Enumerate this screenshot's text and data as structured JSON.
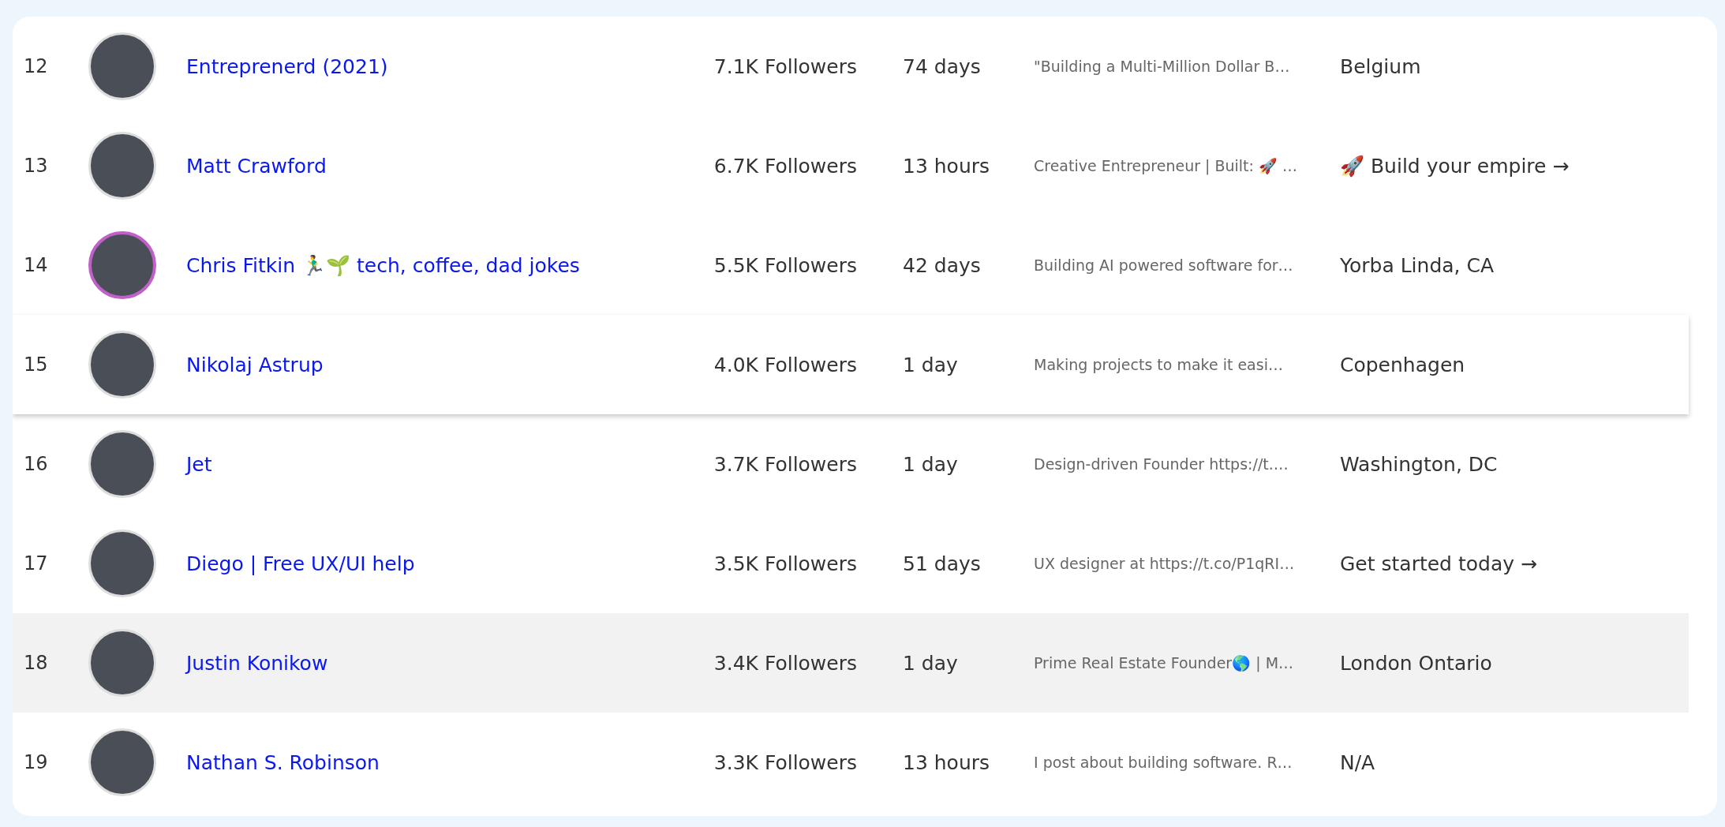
{
  "rows": [
    {
      "rank": "12",
      "name": "Entreprenerd (2021)",
      "followers": "7.1K Followers",
      "time": "74 days",
      "bio": "\"Building a Multi-Million Dollar B…",
      "location": "Belgium",
      "story_ring": false,
      "hovered": false,
      "shaded": false
    },
    {
      "rank": "13",
      "name": "Matt Crawford",
      "followers": "6.7K Followers",
      "time": "13 hours",
      "bio": "Creative Entrepreneur | Built: 🚀 …",
      "location": "🚀 Build your empire →",
      "story_ring": false,
      "hovered": false,
      "shaded": false
    },
    {
      "rank": "14",
      "name": "Chris Fitkin 🏃‍♂️🌱 tech, coffee, dad jokes",
      "followers": "5.5K Followers",
      "time": "42 days",
      "bio": "Building AI powered software for…",
      "location": "Yorba Linda, CA",
      "story_ring": true,
      "hovered": false,
      "shaded": false
    },
    {
      "rank": "15",
      "name": "Nikolaj Astrup",
      "followers": "4.0K Followers",
      "time": "1 day",
      "bio": "Making projects to make it easi…",
      "location": "Copenhagen",
      "story_ring": false,
      "hovered": true,
      "shaded": false
    },
    {
      "rank": "16",
      "name": "Jet",
      "followers": "3.7K Followers",
      "time": "1 day",
      "bio": "Design-driven Founder https://t.…",
      "location": "Washington, DC",
      "story_ring": false,
      "hovered": false,
      "shaded": false
    },
    {
      "rank": "17",
      "name": "Diego | Free UX/UI help",
      "followers": "3.5K Followers",
      "time": "51 days",
      "bio": "UX designer at https://t.co/P1qRI…",
      "location": "Get started today →",
      "story_ring": false,
      "hovered": false,
      "shaded": false
    },
    {
      "rank": "18",
      "name": "Justin Konikow",
      "followers": "3.4K Followers",
      "time": "1 day",
      "bio": "Prime Real Estate Founder🌎 | M…",
      "location": "London Ontario",
      "story_ring": false,
      "hovered": false,
      "shaded": true
    },
    {
      "rank": "19",
      "name": "Nathan S. Robinson",
      "followers": "3.3K Followers",
      "time": "13 hours",
      "bio": "I post about building software. R…",
      "location": "N/A",
      "story_ring": false,
      "hovered": false,
      "shaded": false
    }
  ]
}
